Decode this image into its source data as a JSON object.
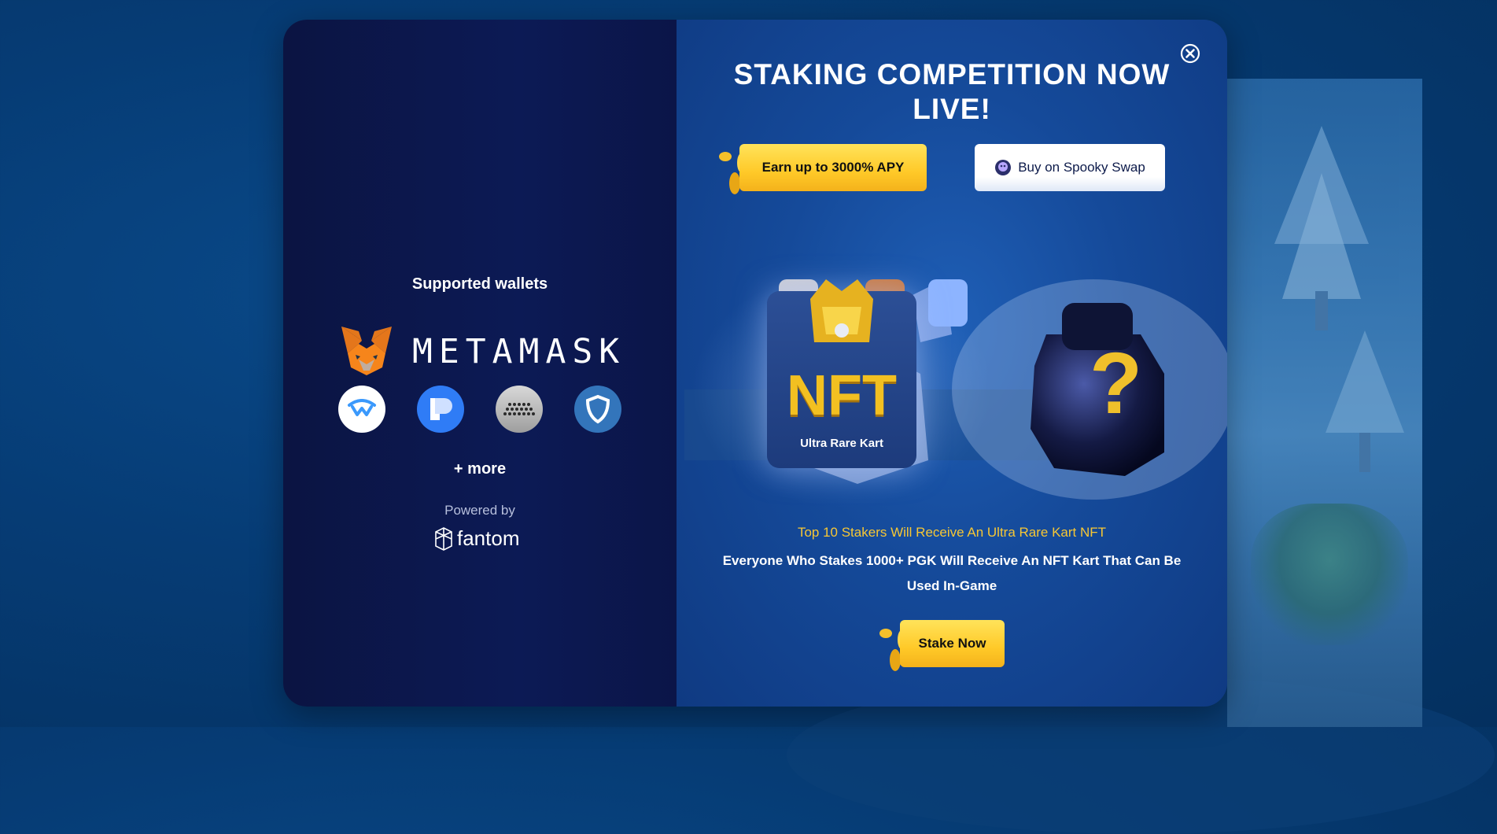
{
  "colors": {
    "page_bg": "#063c75",
    "left_panel": "#0b1548",
    "right_panel": "#154a9a",
    "gold": "#ffc928",
    "highlight_text": "#f7c734"
  },
  "wallets": {
    "title": "Supported wallets",
    "metamask_label": "METAMASK",
    "icons": [
      "walletconnect-icon",
      "portis-icon",
      "coinbase-style-icon",
      "trust-wallet-icon"
    ],
    "more": "+ more",
    "powered_by": "Powered by",
    "network": "fantom"
  },
  "promo": {
    "headline": "STAKING COMPETITION NOW LIVE!",
    "earn_button": "Earn up to 3000% APY",
    "buy_button": "Buy on Spooky Swap",
    "nft_big": "NFT",
    "nft_caption": "Ultra Rare Kart",
    "top_line": "Top 10 Stakers Will Receive An Ultra Rare Kart NFT",
    "bottom_line": "Everyone Who Stakes 1000+ PGK Will Receive An NFT Kart That Can Be Used In-Game",
    "stake_button": "Stake Now"
  }
}
